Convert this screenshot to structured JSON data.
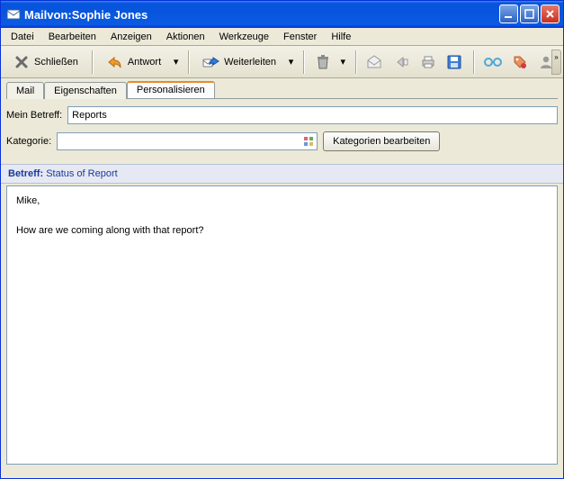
{
  "window": {
    "title": "Mailvon:Sophie Jones"
  },
  "menu": {
    "items": [
      "Datei",
      "Bearbeiten",
      "Anzeigen",
      "Aktionen",
      "Werkzeuge",
      "Fenster",
      "Hilfe"
    ]
  },
  "toolbar": {
    "close_label": "Schließen",
    "reply_label": "Antwort",
    "forward_label": "Weiterleiten"
  },
  "tabs": {
    "items": [
      "Mail",
      "Eigenschaften",
      "Personalisieren"
    ],
    "active_index": 2
  },
  "form": {
    "my_subject_label": "Mein Betreff:",
    "my_subject_value": "Reports",
    "category_label": "Kategorie:",
    "category_value": "",
    "edit_categories_label": "Kategorien bearbeiten"
  },
  "subject": {
    "label": "Betreff:",
    "value": "Status of Report"
  },
  "body": {
    "line1": "Mike,",
    "line2": "How are we coming along with that report?"
  }
}
